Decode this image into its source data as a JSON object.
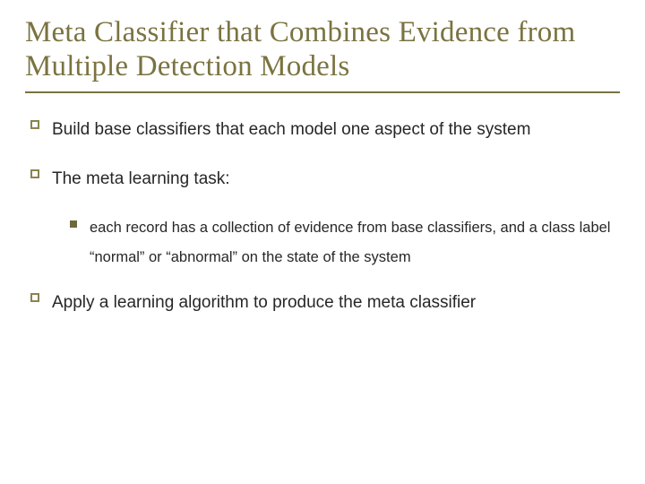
{
  "title": "Meta Classifier that Combines Evidence from Multiple Detection Models",
  "bullets": [
    {
      "text": "Build base classifiers that each model one aspect of the system"
    },
    {
      "text": "The meta learning task:",
      "sub": [
        {
          "text": "each record has a collection of evidence from base classifiers, and a class label “normal” or “abnormal” on the state of the system"
        }
      ]
    },
    {
      "text": "Apply a learning algorithm to produce the meta classifier"
    }
  ]
}
